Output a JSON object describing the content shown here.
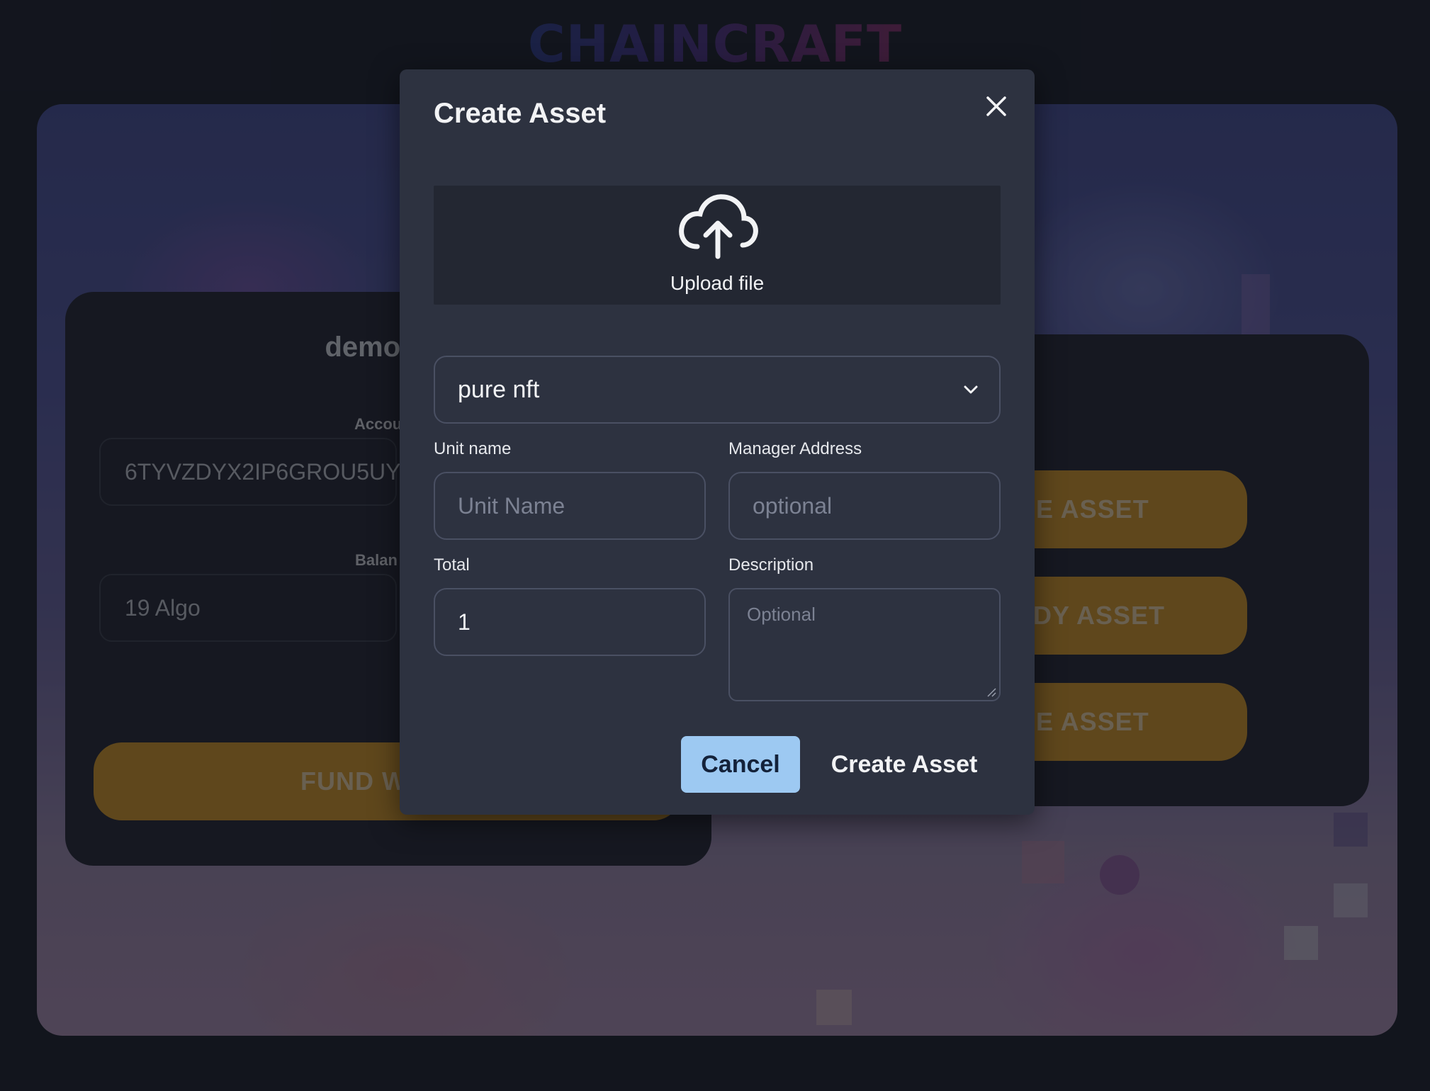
{
  "app": {
    "logo": "CHAINCRAFT"
  },
  "account_card": {
    "email": "demo@al",
    "account_label": "Accou",
    "account_value": "6TYVZDYX2IP6GROU5UY",
    "balance_label": "Balan",
    "balance_value": "19  Algo",
    "fund_button": "FUND W"
  },
  "actions_card": {
    "buttons": [
      "E ASSET",
      "DY ASSET",
      "E ASSET"
    ]
  },
  "modal": {
    "title": "Create Asset",
    "upload_label": "Upload file",
    "asset_type": "pure nft",
    "unit_name_label": "Unit name",
    "unit_name_placeholder": "Unit Name",
    "manager_label": "Manager Address",
    "manager_placeholder": "optional",
    "total_label": "Total",
    "total_value": "1",
    "description_label": "Description",
    "description_placeholder": "Optional",
    "cancel_label": "Cancel",
    "create_label": "Create Asset"
  },
  "colors": {
    "background": "#181a23",
    "modal": "#2d3240",
    "accent_gold": "#8a6520",
    "cancel_button": "#9dc9f2"
  }
}
